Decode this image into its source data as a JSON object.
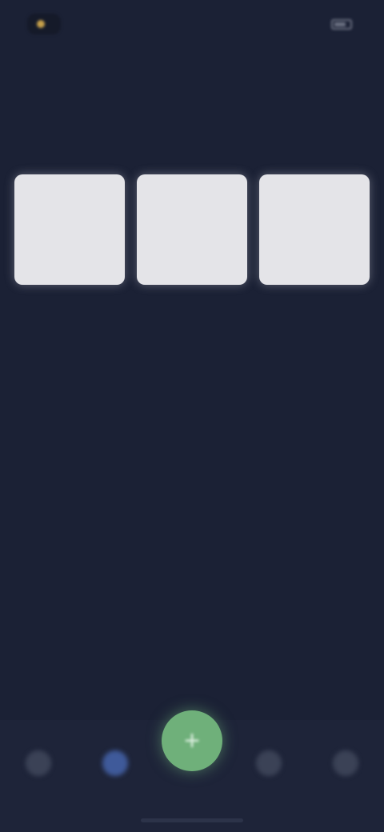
{
  "status_bar": {
    "time": "",
    "battery_icon": "battery-icon"
  },
  "header": {
    "title": "",
    "action_label": ""
  },
  "section": {
    "link_label": ""
  },
  "cards": [
    {
      "label": ""
    },
    {
      "label": ""
    },
    {
      "label": ""
    }
  ],
  "bottom_nav": {
    "items": [
      {
        "icon": "home-icon",
        "active": false
      },
      {
        "icon": "list-icon",
        "active": true
      },
      {
        "icon": "plus-icon",
        "primary": true
      },
      {
        "icon": "chart-icon",
        "active": false
      },
      {
        "icon": "profile-icon",
        "active": false
      }
    ],
    "fab_glyph": "+"
  },
  "colors": {
    "background": "#1b2135",
    "card": "#e4e4e8",
    "accent_blue": "#3f5a9a",
    "fab_green": "#6fb07a"
  }
}
